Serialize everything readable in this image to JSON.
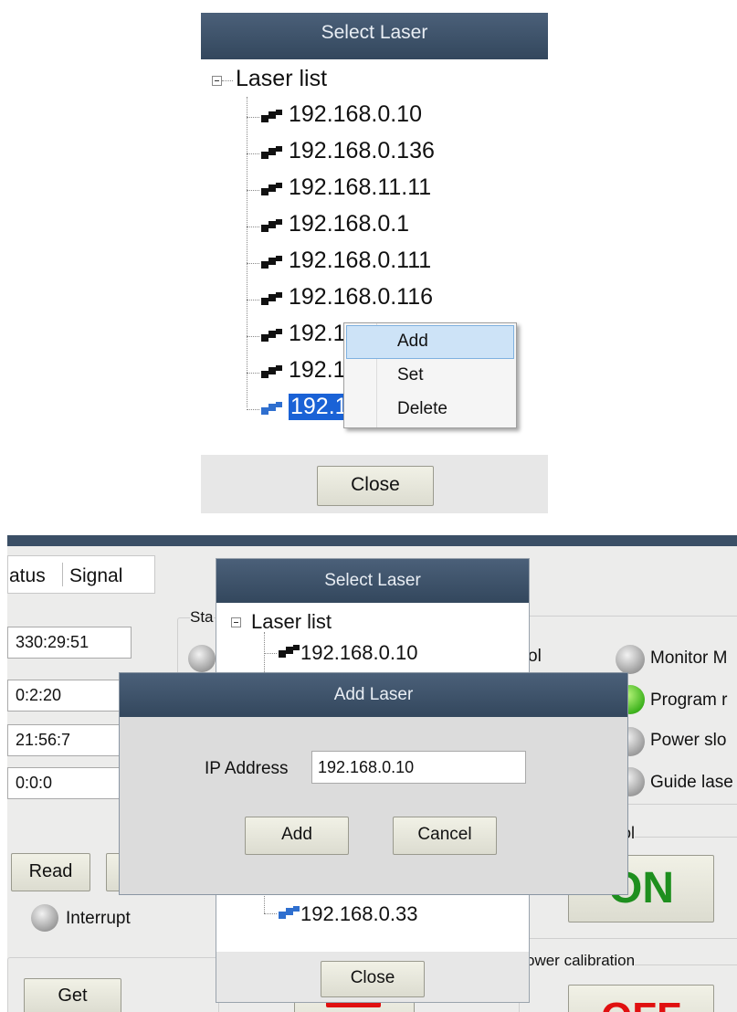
{
  "top_dialog": {
    "title": "Select Laser",
    "tree_root": "Laser list",
    "items": [
      "192.168.0.10",
      "192.168.0.136",
      "192.168.11.11",
      "192.168.0.1",
      "192.168.0.111",
      "192.168.0.116",
      "192.1",
      "192.1",
      "192.1"
    ],
    "close_label": "Close"
  },
  "context_menu": {
    "items": [
      "Add",
      "Set",
      "Delete"
    ],
    "highlighted": "Add"
  },
  "app": {
    "tabs": [
      "atus",
      "Signal"
    ],
    "status_group_label": "Sta",
    "fields": [
      "330:29:51",
      "0:2:20",
      "21:56:7",
      "0:0:0"
    ],
    "read_label": "Read",
    "interrupt_label": "Interrupt",
    "get_label": "Get",
    "right_labels": [
      "ol",
      "Monitor M",
      "Program r",
      "Power slo",
      "Guide lase"
    ],
    "control_label": "ntrol",
    "on_label": "ON",
    "power_calibration_label": "ower  calibration",
    "off_label": "OFF",
    "colors": {
      "on_text": "#1e8f1e",
      "off_text": "#e01010",
      "title_bar": "#3b4f66"
    }
  },
  "bottom_select_dialog": {
    "title": "Select Laser",
    "tree_root": "Laser list",
    "first_item": "192.168.0.10",
    "last_item": "192.168.0.33",
    "close_label": "Close"
  },
  "add_dialog": {
    "title": "Add Laser",
    "ip_label": "IP Address",
    "ip_value": "192.168.0.10",
    "add_label": "Add",
    "cancel_label": "Cancel"
  }
}
